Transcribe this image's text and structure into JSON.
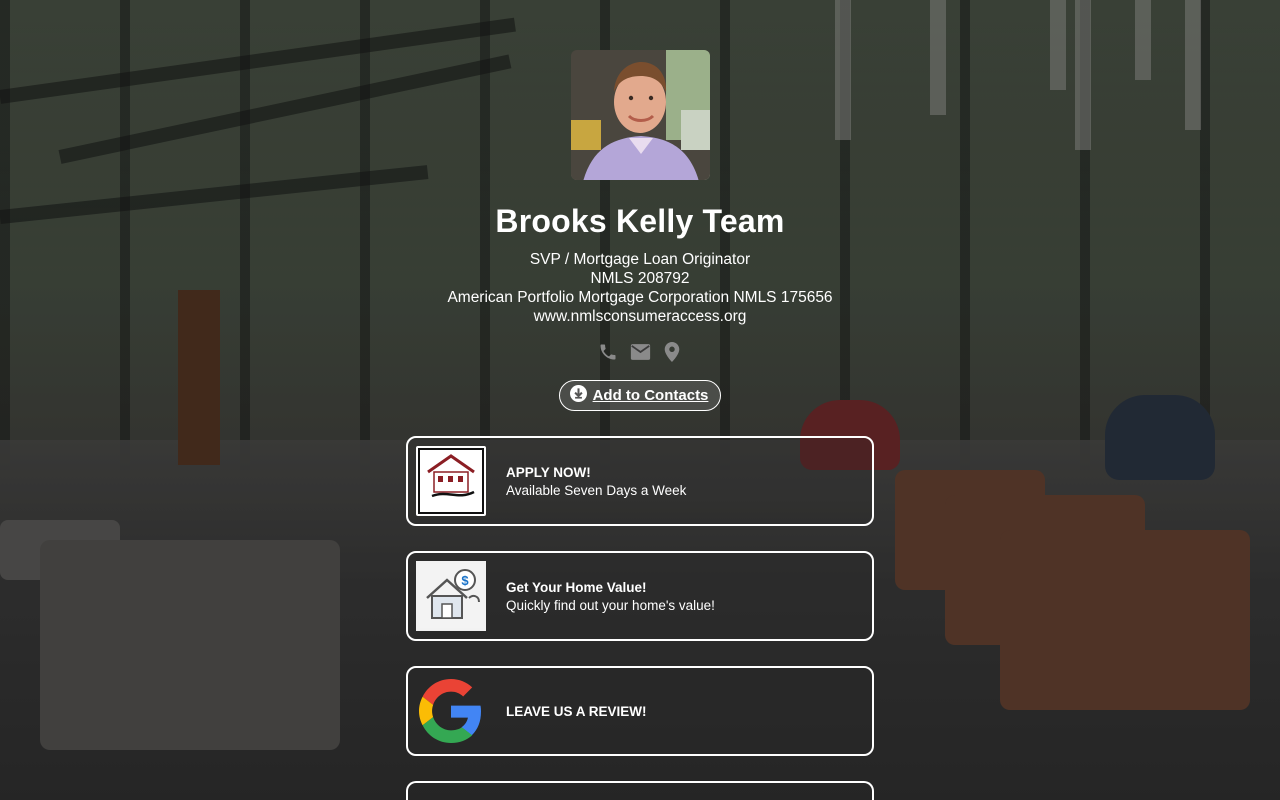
{
  "profile": {
    "name": "Brooks Kelly Team",
    "title": "SVP / Mortgage Loan Originator",
    "nmls": "NMLS 208792",
    "company": "American Portfolio Mortgage Corporation NMLS 175656",
    "website": "www.nmlsconsumeraccess.org"
  },
  "contact_icons": [
    "phone-icon",
    "email-icon",
    "location-pin-icon"
  ],
  "add_contacts": {
    "label": "Add to Contacts",
    "icon": "download-icon"
  },
  "links": [
    {
      "title": "APPLY NOW!",
      "subtitle": "Available Seven Days a Week",
      "thumb": "apmc-logo",
      "thumb_text": "APMC"
    },
    {
      "title": "Get Your Home Value!",
      "subtitle": "Quickly find out your home's value!",
      "thumb": "house-value-icon"
    },
    {
      "title": "LEAVE US A REVIEW!",
      "subtitle": "",
      "thumb": "google-logo"
    }
  ],
  "colors": {
    "card_border": "#ffffff",
    "text": "#ffffff",
    "apmc_red": "#8b1e24",
    "google_blue": "#4285F4",
    "google_red": "#EA4335",
    "google_yellow": "#FBBC05",
    "google_green": "#34A853"
  }
}
